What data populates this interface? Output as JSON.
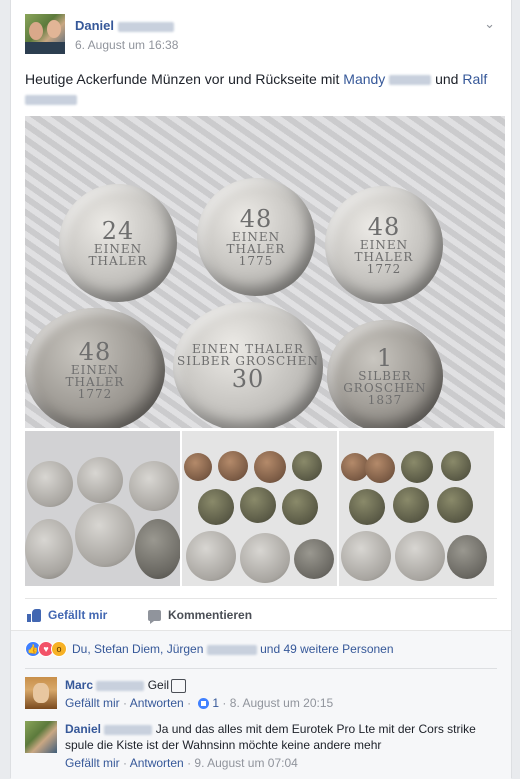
{
  "post": {
    "author_first": "Daniel",
    "timestamp": "6. August um 16:38",
    "menu_icon": "chevron-down-icon",
    "text_part1": "Heutige Ackerfunde Münzen vor und Rückseite mit ",
    "mention1_first": "Mandy",
    "text_part2": " und ",
    "mention2_first": "Ralf",
    "coins": [
      {
        "top": "24",
        "mid": "EINEN",
        "low": "THALER"
      },
      {
        "top": "48",
        "mid": "EINEN",
        "low": "THALER",
        "year": "1775"
      },
      {
        "top": "48",
        "mid": "EINEN",
        "low": "THALER",
        "year": "1772"
      },
      {
        "top": "48",
        "mid": "EINEN",
        "low": "THALER",
        "year": "1772"
      },
      {
        "top": "30",
        "mid": "EINEN THALER",
        "low": "SILBER GROSCHEN"
      },
      {
        "top": "1",
        "mid": "SILBER",
        "low": "GROSCHEN",
        "year": "1837"
      }
    ]
  },
  "actions": {
    "like_label": "Gefällt mir",
    "comment_label": "Kommentieren"
  },
  "reactions": {
    "text_prefix": "Du, Stefan Diem, Jürgen",
    "text_suffix": "und 49 weitere Personen"
  },
  "comments": [
    {
      "author_first": "Marc",
      "text": "Geil",
      "like_label": "Gefällt mir",
      "reply_label": "Antworten",
      "like_count": "1",
      "timestamp": "8. August um 20:15"
    },
    {
      "author_first": "Daniel",
      "text": "Ja und das alles mit dem Eurotek Pro Lte mit der Cors strike spule die Kiste ist der Wahnsinn möchte keine andere mehr",
      "like_label": "Gefällt mir",
      "reply_label": "Antworten",
      "timestamp": "9. August um 07:04"
    }
  ]
}
